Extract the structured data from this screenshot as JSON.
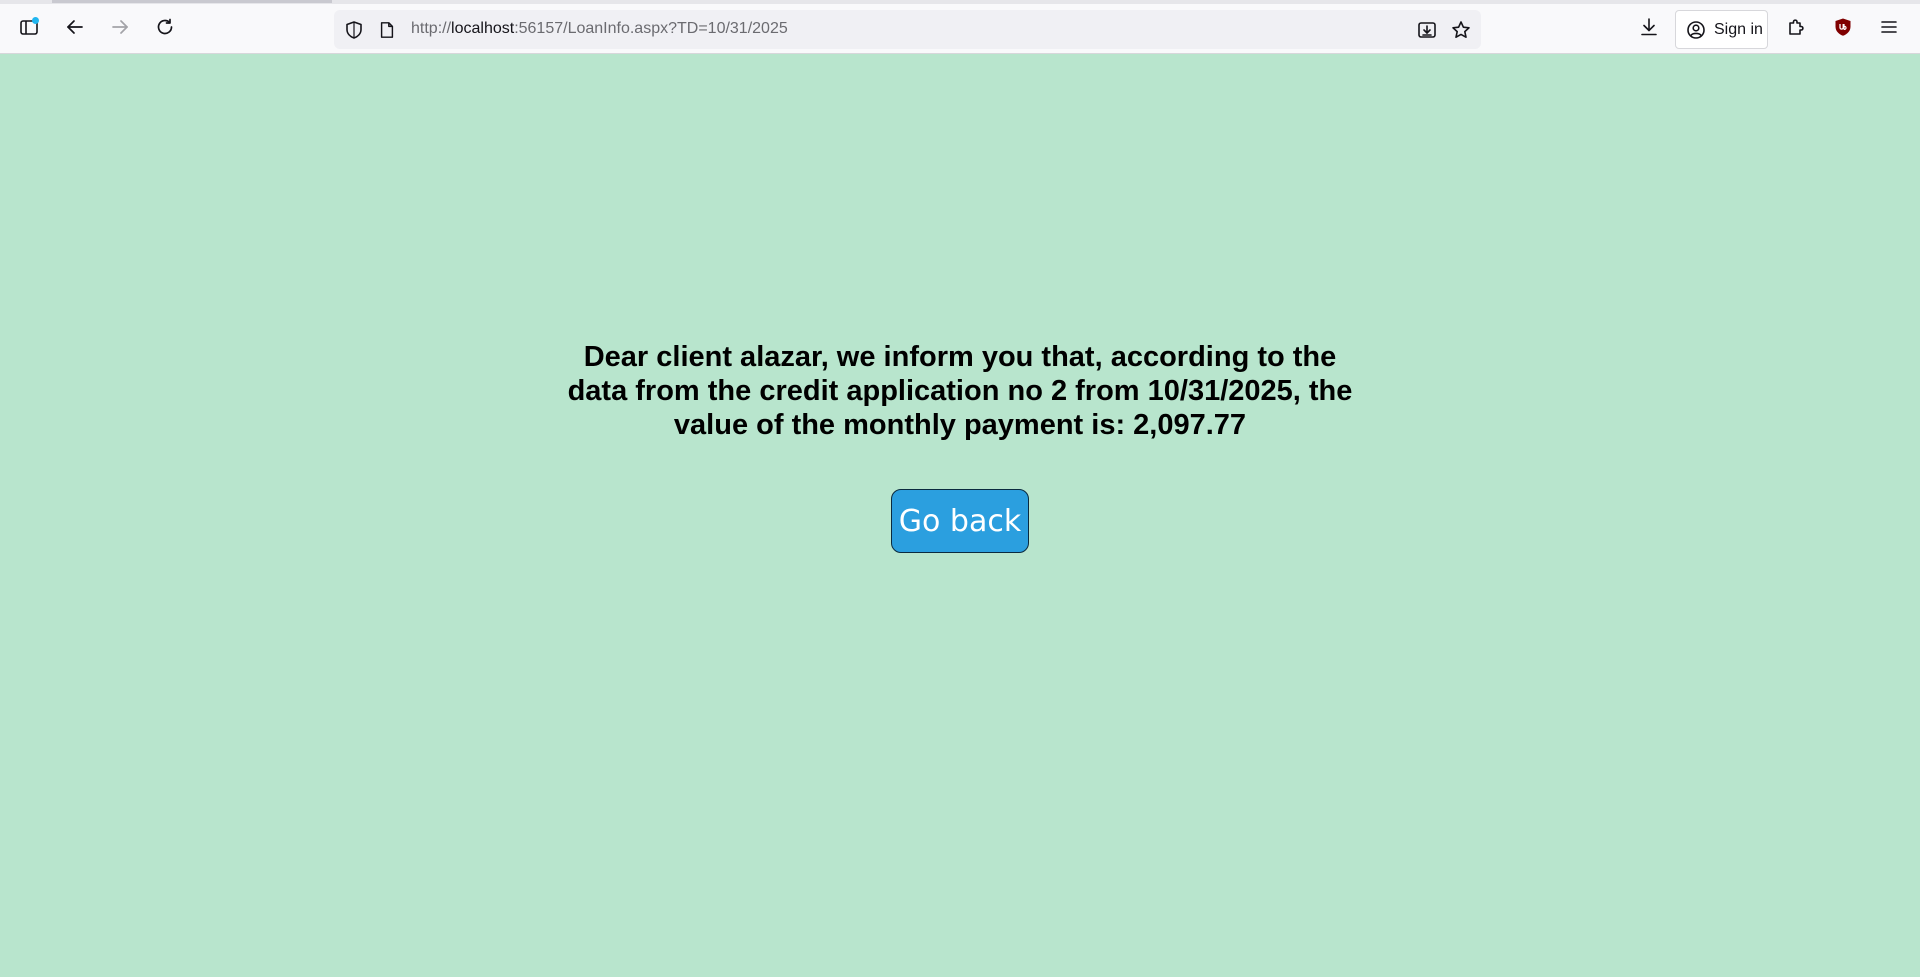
{
  "browser": {
    "url_prefix": "http://",
    "url_host": "localhost",
    "url_rest": ":56157/LoanInfo.aspx?TD=10/31/2025",
    "signin_label": "Sign in",
    "icons": {
      "sidebar": "sidebar-icon",
      "back": "arrow-left-icon",
      "forward": "arrow-right-icon",
      "reload": "reload-icon",
      "shield": "shield-icon",
      "page": "page-icon",
      "save": "save-page-icon",
      "bookmark": "star-icon",
      "downloads": "download-icon",
      "account": "account-icon",
      "extensions": "puzzle-icon",
      "ublock": "ublock-icon",
      "menu": "hamburger-icon"
    }
  },
  "page": {
    "message": "Dear client alazar, we inform you that, according to the data from the credit application no 2 from 10/31/2025, the value of the monthly payment is: 2,097.77",
    "go_back_label": "Go back",
    "colors": {
      "background": "#b8e5cd",
      "button": "#2b9fdf"
    }
  }
}
